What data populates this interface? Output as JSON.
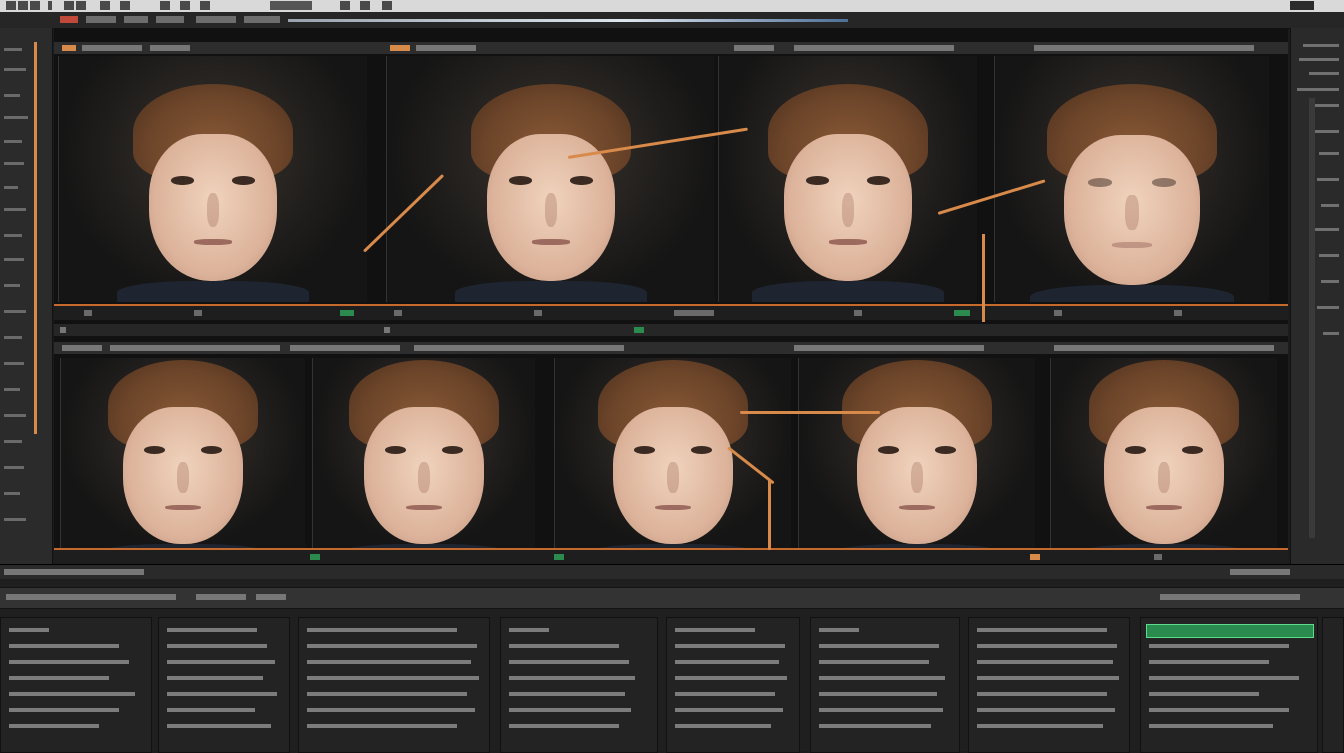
{
  "window": {
    "title": "",
    "accent": "#d88a4a",
    "status_green": "#2b8a4e"
  },
  "toolbar": {
    "icons": [
      "menu-icon",
      "grid-icon",
      "settings-icon",
      "search-icon",
      "window-controls-icon"
    ]
  },
  "viewer": {
    "rows": [
      {
        "frames": 4
      },
      {
        "frames": 5
      }
    ]
  },
  "bottom": {
    "panes": 8
  }
}
